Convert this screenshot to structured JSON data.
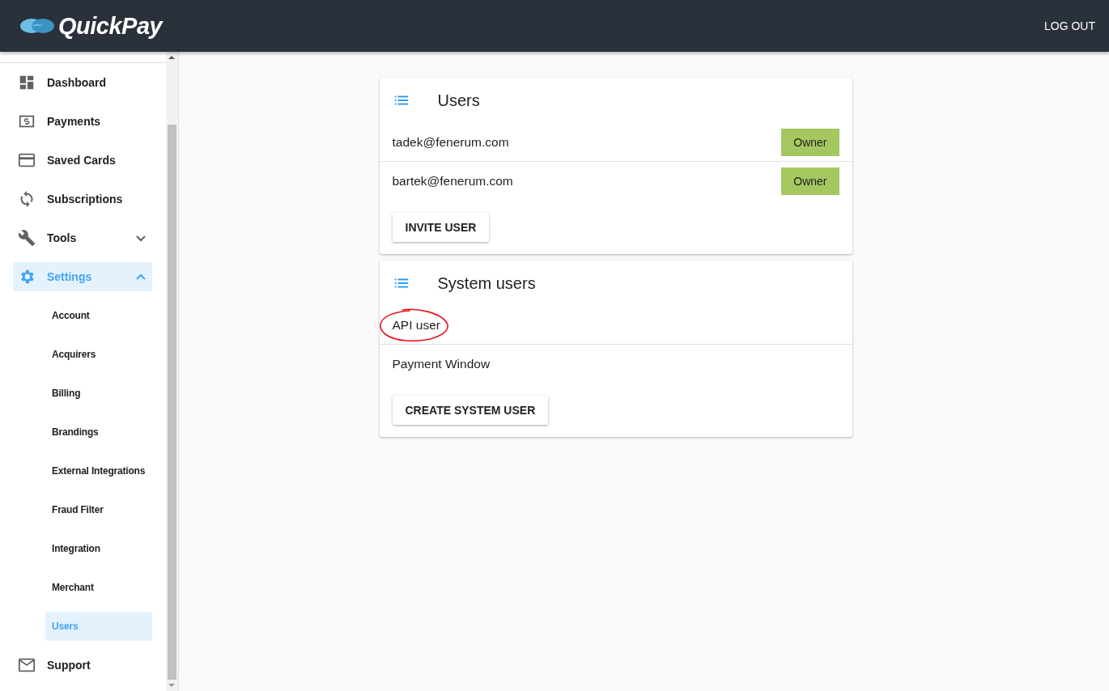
{
  "header": {
    "logo": "QuickPay",
    "logout": "LOG OUT"
  },
  "sidebar": {
    "items": [
      {
        "label": "Dashboard",
        "kind": "item",
        "selected": false
      },
      {
        "label": "Payments",
        "kind": "item",
        "selected": false
      },
      {
        "label": "Saved Cards",
        "kind": "item",
        "selected": false
      },
      {
        "label": "Subscriptions",
        "kind": "item",
        "selected": false
      },
      {
        "label": "Tools",
        "kind": "group",
        "selected": false,
        "expanded": false
      },
      {
        "label": "Settings",
        "kind": "group",
        "selected": true,
        "expanded": true,
        "children": [
          {
            "label": "Account",
            "selected": false
          },
          {
            "label": "Acquirers",
            "selected": false
          },
          {
            "label": "Billing",
            "selected": false
          },
          {
            "label": "Brandings",
            "selected": false
          },
          {
            "label": "External Integrations",
            "selected": false
          },
          {
            "label": "Fraud Filter",
            "selected": false
          },
          {
            "label": "Integration",
            "selected": false
          },
          {
            "label": "Merchant",
            "selected": false
          },
          {
            "label": "Users",
            "selected": true
          }
        ]
      },
      {
        "label": "Support",
        "kind": "item",
        "selected": false
      }
    ]
  },
  "cards": [
    {
      "title": "Users",
      "rows": [
        {
          "name": "tadek@fenerum.com",
          "role": "Owner",
          "circled": false
        },
        {
          "name": "bartek@fenerum.com",
          "role": "Owner",
          "circled": false
        }
      ],
      "button": "INVITE USER"
    },
    {
      "title": "System users",
      "rows": [
        {
          "name": "API user",
          "circled": true
        },
        {
          "name": "Payment Window",
          "circled": false
        }
      ],
      "button": "CREATE SYSTEM USER"
    }
  ]
}
